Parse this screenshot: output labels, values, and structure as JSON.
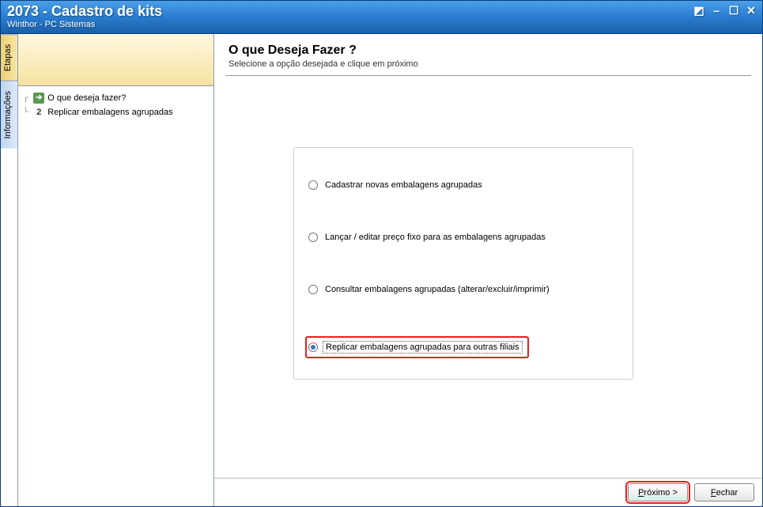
{
  "window": {
    "title": "2073 - Cadastro de kits",
    "subtitle": "Winthor - PC Sistemas"
  },
  "sidebar": {
    "tabs": {
      "etapas": "Etapas",
      "informacoes": "Informações"
    },
    "tree": {
      "item1": "O que deseja fazer?",
      "item2_num": "2",
      "item2": "Replicar embalagens agrupadas"
    }
  },
  "main": {
    "title": "O que Deseja Fazer ?",
    "subtitle": "Selecione a opção desejada e clique em próximo",
    "options": {
      "opt1": "Cadastrar novas embalagens agrupadas",
      "opt2": "Lançar / editar preço fixo para as embalagens agrupadas",
      "opt3": "Consultar embalagens agrupadas (alterar/excluir/imprimir)",
      "opt4": "Replicar embalagens agrupadas para outras filiais"
    }
  },
  "footer": {
    "next_prefix": "P",
    "next_rest": "róximo >",
    "close_prefix": "F",
    "close_rest": "echar"
  }
}
